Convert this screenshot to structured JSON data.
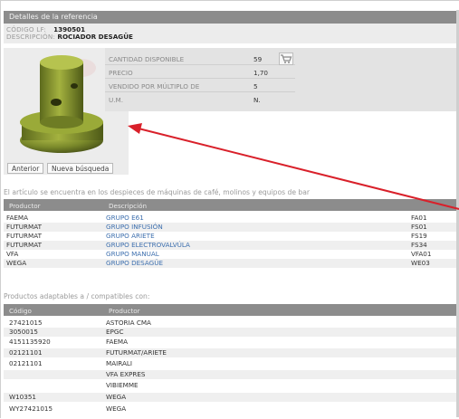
{
  "header": {
    "title": "Detalles de la referencia"
  },
  "reference": {
    "code_label": "CÓDIGO LF:",
    "code_value": "1390501",
    "desc_label": "DESCRIPCIÓN:",
    "desc_value": "ROCIADOR DESAGÜE"
  },
  "details": [
    {
      "label": "CANTIDAD DISPONIBLE",
      "value": "59"
    },
    {
      "label": "PRECIO",
      "value": "1,70"
    },
    {
      "label": "VENDIDO POR MÚLTIPLO DE",
      "value": "5"
    },
    {
      "label": "U.M.",
      "value": "N."
    }
  ],
  "image_buttons": {
    "prev": "Anterior",
    "new_search": "Nueva búsqueda"
  },
  "icons": {
    "cart": "shopping-cart-icon"
  },
  "exploded_section": {
    "title": "El artículo se encuentra en los despieces de máquinas de café, molinos y equipos de bar",
    "headers": [
      "Productor",
      "Descripción"
    ],
    "rows": [
      {
        "producer": "FAEMA",
        "description": "GRUPO E61",
        "code": "FA01"
      },
      {
        "producer": "FUTURMAT",
        "description": "GRUPO INFUSIÓN",
        "code": "FS01"
      },
      {
        "producer": "FUTURMAT",
        "description": "GRUPO ARIETE",
        "code": "FS19"
      },
      {
        "producer": "FUTURMAT",
        "description": "GRUPO ELECTROVALVÚLA",
        "code": "FS34"
      },
      {
        "producer": "VFA",
        "description": "GRUPO MANUAL",
        "code": "VFA01"
      },
      {
        "producer": "WEGA",
        "description": "GRUPO DESAGÜE",
        "code": "WE03"
      }
    ]
  },
  "compatible_section": {
    "title": "Productos adaptables a / compatibles con:",
    "headers": [
      "Código",
      "Productor"
    ],
    "rows": [
      {
        "code": "27421015",
        "producer": "ASTORIA CMA"
      },
      {
        "code": "3050015",
        "producer": "EPGC"
      },
      {
        "code": "4151135920",
        "producer": "FAEMA"
      },
      {
        "code": "02121101",
        "producer": "FUTURMAT/ARIETE"
      },
      {
        "code": "02121101",
        "producer": "MAIRALI"
      },
      {
        "code": "",
        "producer": "VFA EXPRES"
      },
      {
        "code": "",
        "producer": "VIBIEMME"
      },
      {
        "code": "W10351",
        "producer": "WEGA"
      },
      {
        "code": "WY27421015",
        "producer": "WEGA"
      }
    ]
  },
  "colors": {
    "header_bg": "#8c8c8c",
    "link": "#3d6fae",
    "arrow": "#d9202a",
    "part": "#7a8a2a"
  }
}
